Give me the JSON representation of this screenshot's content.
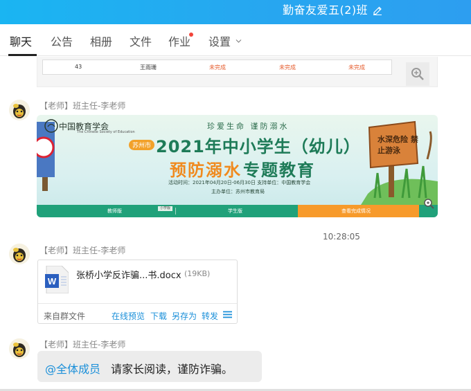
{
  "header": {
    "group_title": "勤奋友爱五(2)班",
    "edit_icon": "edit-pencil-icon"
  },
  "tabs": [
    {
      "label": "聊天",
      "active": true
    },
    {
      "label": "公告",
      "active": false
    },
    {
      "label": "相册",
      "active": false
    },
    {
      "label": "文件",
      "active": false
    },
    {
      "label": "作业",
      "active": false,
      "badge": "red-dot"
    },
    {
      "label": "设置",
      "active": false,
      "dropdown": true
    }
  ],
  "top_card": {
    "row": [
      "43",
      "王雨珊",
      "未完成",
      "未完成",
      "未完成"
    ],
    "zoom_icon": "zoom-in-icon"
  },
  "messages": [
    {
      "sender": "【老师】班主任-李老师",
      "type": "image",
      "banner": {
        "tagline": "珍爱生命  谨防溺水",
        "org": "中国教育学会",
        "org_en": "The Chinese Society of Education",
        "city_tag": "苏州市",
        "title_line1": "2021年中小学生（幼儿）",
        "title_line2_a": "预防溺水",
        "title_line2_b": "专题教育",
        "info_line1": "活动时间：2021年04月20日-06月30日   支持单位：中国教育学会",
        "info_line2": "主办单位：苏州市教育局",
        "sign_text": "水深危险 禁止游泳",
        "buttons": [
          "教师版",
          "学生版",
          "查看完成情况"
        ],
        "small_tag": "小学版"
      }
    },
    {
      "timestamp": "10:28:05"
    },
    {
      "sender": "【老师】班主任-李老师",
      "type": "file",
      "file": {
        "name": "张桥小学反诈骗...书.docx",
        "size": "(19KB)",
        "from": "来自群文件",
        "actions": [
          "在线预览",
          "下载",
          "另存为",
          "转发"
        ],
        "icon": "word-doc-icon"
      }
    },
    {
      "sender": "【老师】班主任-李老师",
      "type": "text",
      "mention": "@全体成员",
      "text": "请家长阅读，谨防诈骗。"
    }
  ],
  "colors": {
    "header_bg": "#26a8f0",
    "link": "#1a8fd9",
    "badge_red": "#f2443a",
    "banner_green": "#1e7b58",
    "banner_orange": "#f08a1e"
  }
}
